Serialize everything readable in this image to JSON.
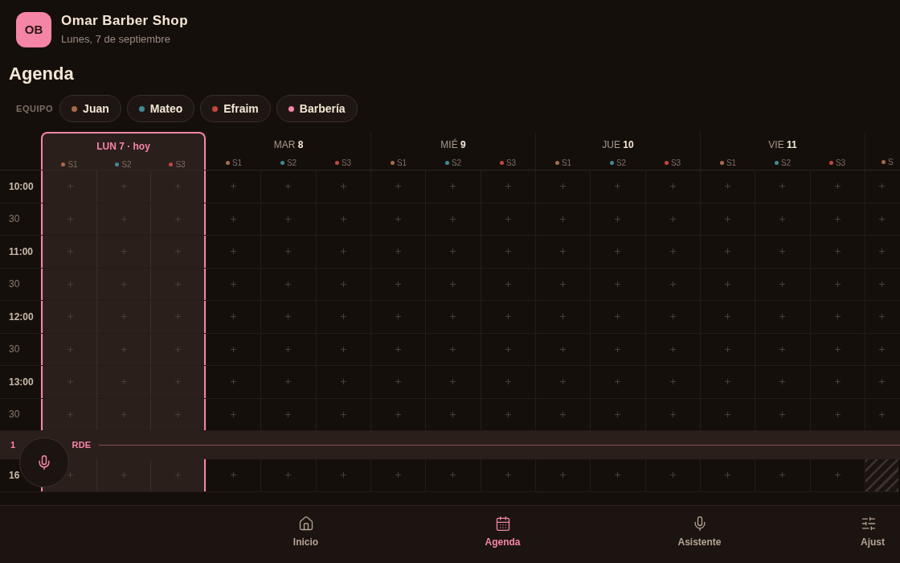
{
  "header": {
    "avatar": "OB",
    "title": "Omar Barber Shop",
    "subtitle": "Lunes, 7 de septiembre"
  },
  "page_title": "Agenda",
  "team": {
    "label": "EQUIPO",
    "members": [
      {
        "name": "Juan",
        "color": "#a86b4a"
      },
      {
        "name": "Mateo",
        "color": "#3f8a96"
      },
      {
        "name": "Efraim",
        "color": "#c2473f"
      },
      {
        "name": "Barbería",
        "color": "#f585a6"
      }
    ]
  },
  "days": [
    {
      "name": "LUN",
      "number": "7",
      "today_label": "· hoy",
      "selected": true,
      "staff": [
        {
          "label": "S1",
          "color": "#a86b4a"
        },
        {
          "label": "S2",
          "color": "#3f8a96"
        },
        {
          "label": "S3",
          "color": "#c2473f"
        }
      ]
    },
    {
      "name": "MAR",
      "number": "8",
      "selected": false,
      "staff": [
        {
          "label": "S1",
          "color": "#a86b4a"
        },
        {
          "label": "S2",
          "color": "#3f8a96"
        },
        {
          "label": "S3",
          "color": "#c2473f"
        }
      ]
    },
    {
      "name": "MIÉ",
      "number": "9",
      "selected": false,
      "staff": [
        {
          "label": "S1",
          "color": "#a86b4a"
        },
        {
          "label": "S2",
          "color": "#3f8a96"
        },
        {
          "label": "S3",
          "color": "#c2473f"
        }
      ]
    },
    {
      "name": "JUE",
      "number": "10",
      "selected": false,
      "staff": [
        {
          "label": "S1",
          "color": "#a86b4a"
        },
        {
          "label": "S2",
          "color": "#3f8a96"
        },
        {
          "label": "S3",
          "color": "#c2473f"
        }
      ]
    },
    {
      "name": "VIE",
      "number": "11",
      "selected": false,
      "staff": [
        {
          "label": "S1",
          "color": "#a86b4a"
        },
        {
          "label": "S2",
          "color": "#3f8a96"
        },
        {
          "label": "S3",
          "color": "#c2473f"
        }
      ]
    },
    {
      "selected": false,
      "closed_afternoon": true,
      "staff": [
        {
          "label": "S",
          "color": "#a86b4a"
        }
      ]
    }
  ],
  "rows": [
    {
      "kind": "slot",
      "time": "10:00",
      "hour": true
    },
    {
      "kind": "slot",
      "time": "30",
      "hour": false
    },
    {
      "kind": "slot",
      "time": "11:00",
      "hour": true
    },
    {
      "kind": "slot",
      "time": "30",
      "hour": false
    },
    {
      "kind": "slot",
      "time": "12:00",
      "hour": true
    },
    {
      "kind": "slot",
      "time": "30",
      "hour": false
    },
    {
      "kind": "slot",
      "time": "13:00",
      "hour": true
    },
    {
      "kind": "slot",
      "time": "30",
      "hour": false
    },
    {
      "kind": "break",
      "label_start": "1",
      "label_end": "RDE"
    },
    {
      "kind": "slot",
      "time": "16",
      "hour": true
    }
  ],
  "nav": [
    {
      "kind": "home",
      "label": "Inicio",
      "selected": false
    },
    {
      "kind": "calendar",
      "label": "Agenda",
      "selected": true
    },
    {
      "kind": "mic",
      "label": "Asistente",
      "selected": false
    },
    {
      "kind": "sliders",
      "label": "Ajust",
      "selected": false
    }
  ]
}
